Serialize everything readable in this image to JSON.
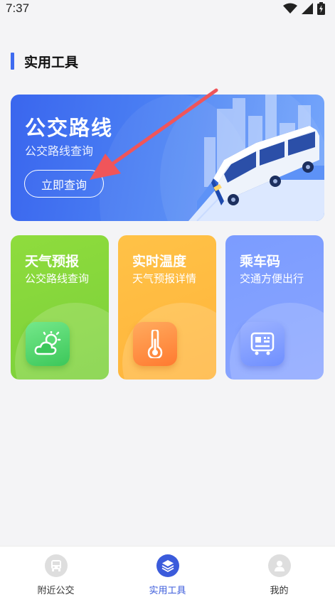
{
  "status_bar": {
    "time": "7:37"
  },
  "section": {
    "title": "实用工具"
  },
  "bus_card": {
    "title": "公交路线",
    "subtitle": "公交路线查询",
    "button_label": "立即查询"
  },
  "tools": [
    {
      "title": "天气预报",
      "subtitle": "公交路线查询",
      "icon": "weather-icon",
      "color": "#86d63c"
    },
    {
      "title": "实时温度",
      "subtitle": "天气预报详情",
      "icon": "thermometer-icon",
      "color": "#ffbb42"
    },
    {
      "title": "乘车码",
      "subtitle": "交通方便出行",
      "icon": "bus-code-icon",
      "color": "#809fff"
    }
  ],
  "bottom_nav": {
    "items": [
      {
        "label": "附近公交",
        "icon": "bus-icon",
        "active": false
      },
      {
        "label": "实用工具",
        "icon": "layers-icon",
        "active": true
      },
      {
        "label": "我的",
        "icon": "user-icon",
        "active": false
      }
    ]
  },
  "colors": {
    "accent": "#3b5bdb",
    "arrow": "#f0555a"
  }
}
